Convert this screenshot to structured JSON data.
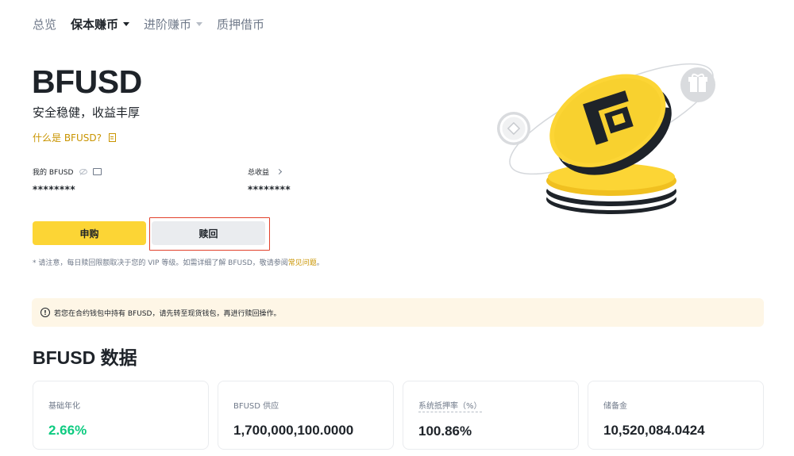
{
  "nav": {
    "items": [
      {
        "label": "总览",
        "active": false,
        "dropdown": false
      },
      {
        "label": "保本赚币",
        "active": true,
        "dropdown": true
      },
      {
        "label": "进阶赚币",
        "active": false,
        "dropdown": true
      },
      {
        "label": "质押借币",
        "active": false,
        "dropdown": false
      }
    ]
  },
  "hero": {
    "title": "BFUSD",
    "subtitle": "安全稳健，收益丰厚",
    "what_link": "什么是 BFUSD?"
  },
  "balances": {
    "my_label": "我的 BFUSD",
    "my_value": "********",
    "total_label": "总收益",
    "total_value": "********"
  },
  "actions": {
    "buy_label": "申购",
    "redeem_label": "赎回"
  },
  "notice": {
    "text": "* 请注意，每日赎回限额取决于您的 VIP 等级。如需详细了解 BFUSD，敬请参阅",
    "faq_link": "常见问题",
    "end": "。"
  },
  "alert": {
    "icon": "!",
    "text": "若您在合约钱包中持有 BFUSD，请先转至现货钱包，再进行赎回操作。"
  },
  "data_section": {
    "title": "BFUSD 数据",
    "cards": [
      {
        "label": "基础年化",
        "value": "2.66%"
      },
      {
        "label": "BFUSD 供应",
        "value": "1,700,000,100.0000"
      },
      {
        "label": "系统抵押率（%）",
        "value": "100.86%"
      },
      {
        "label": "储备金",
        "value": "10,520,084.0424"
      }
    ]
  },
  "colors": {
    "brand_yellow": "#fcd535",
    "link_gold": "#c99400",
    "positive_green": "#0ecb81",
    "highlight_red": "#e2412b"
  }
}
